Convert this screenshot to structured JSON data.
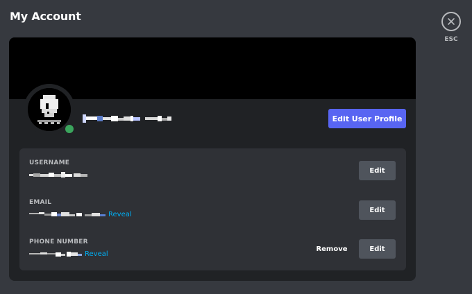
{
  "header": {
    "title": "My Account"
  },
  "close": {
    "label": "ESC",
    "icon": "close-icon"
  },
  "profile": {
    "edit_button_label": "Edit User Profile",
    "status": "online",
    "status_color": "#3ba55d",
    "accent_color": "#5865f2"
  },
  "fields": {
    "username": {
      "label": "USERNAME",
      "edit_label": "Edit"
    },
    "email": {
      "label": "EMAIL",
      "reveal_label": "Reveal",
      "edit_label": "Edit"
    },
    "phone": {
      "label": "PHONE NUMBER",
      "reveal_label": "Reveal",
      "remove_label": "Remove",
      "edit_label": "Edit"
    }
  },
  "colors": {
    "link": "#00aff4",
    "background": "#36393f",
    "card": "#202225",
    "panel": "#2f3136"
  }
}
